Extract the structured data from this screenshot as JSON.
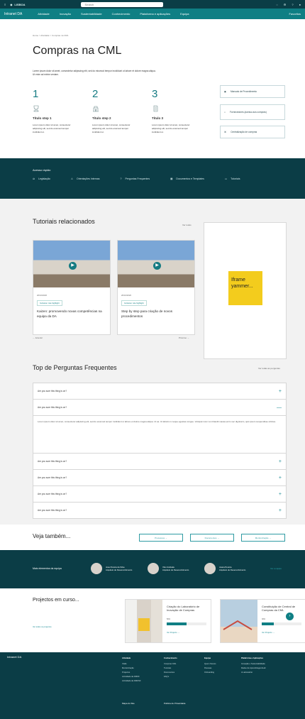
{
  "topbar": {
    "logo": "LISBOA",
    "search": "Search"
  },
  "nav": {
    "brand": "Intranet DA",
    "items": [
      "Atividade",
      "Inovação",
      "Sustentabilidade",
      "Conhecimento",
      "Plataforma e aplicações",
      "Equipa"
    ],
    "right": "Favoritos"
  },
  "page": {
    "breadcrumb": "Home > Atividade > Compras na CML",
    "title": "Compras na CML",
    "intro": "Lorem ipsum dolor sit amet, consectetur adipiscing elit, sed do eiusmod tempor incididunt ut labore et dolore magna aliqua. Ut enim ad minim veniam.",
    "steps": [
      {
        "num": "1",
        "title": "Título step 1",
        "text": "Lorem ipsum dolor sit amet, consectetur adipiscing elit, sed do eiusmod tempor incididunt ut."
      },
      {
        "num": "2",
        "title": "Título step 2",
        "text": "Lorem ipsum dolor sit amet, consectetur adipiscing elit, sed do eiusmod tempor incididunt ut."
      },
      {
        "num": "3",
        "title": "Título 3",
        "text": "Lorem ipsum dolor sit amet, consectetur adipiscing elit, sed do eiusmod tempor incididunt ut."
      }
    ],
    "side": [
      "Manuais de Procedimento",
      "Fornecedores (acesso aos compras)",
      "Centralização de compras"
    ]
  },
  "quick": {
    "label": "Acesso rápido",
    "items": [
      "Legislação",
      "Orientações Internas",
      "Perguntas Frequentes",
      "Documentos e Templates",
      "Tutoriais"
    ]
  },
  "tutorials": {
    "title": "Tutoriais relacionados",
    "more": "Ver todos",
    "cards": [
      {
        "date": "20/10/2020",
        "tag": "Inclusion rule highlight",
        "title": "Kaizen: promovendo novas competências na equipa da DA"
      },
      {
        "date": "20/10/2020",
        "tag": "Inclusion rule highlight",
        "title": "Step by step para criação de novos procedimentos"
      }
    ],
    "prev": "← Anterior",
    "next": "Próximo →",
    "iframe": "Iframe yammer..."
  },
  "faq": {
    "title": "Top de Perguntas Frequentes",
    "more": "Ver todas as perguntas",
    "questions": [
      "Are you sure this thing is on?",
      "Are you sure this thing is on?",
      "Are you sure this thing is on?",
      "Are you sure this thing is on?",
      "Are you sure this thing is on?",
      "Are you sure this thing is on?"
    ],
    "answer": "Lorem ipsum dolor sit amet, consectetur adipiscing elit, sed do eiusmod tempor incididunt ut labore et dolore magna aliqua. Ut as. Ut laboris in neque egestas congue. Volutpat nunc non blandit massa enim nec dignissim, quis ipsum suspendisse ultrices."
  },
  "also": {
    "title": "Veja também...",
    "buttons": [
      "Processos →",
      "Documentos →",
      "Monitorização →"
    ]
  },
  "team": {
    "label": "Mais elementos da equipa",
    "members": [
      {
        "name": "Jose Pereira da Silva",
        "role": "Arquiteto de Desenvolvimento"
      },
      {
        "name": "Vitor Andrade",
        "role": "Arquiteto de Desenvolvimento"
      },
      {
        "name": "Joana Pereira",
        "role": "Arquiteto de Desenvolvimento"
      }
    ],
    "more": "Ver a equipa"
  },
  "projects": {
    "title": "Projectos em curso...",
    "all": "Ver todos os projectos",
    "cards": [
      {
        "title": "Criação do Laboratório de Inovação de Compras",
        "percent": "50%",
        "link": "Ver Projecto →",
        "progress": 0.5
      },
      {
        "title": "Constituição de Central de Compras da CML",
        "percent": "30%",
        "link": "Ver Projecto →",
        "progress": 0.3
      }
    ]
  },
  "footer": {
    "brand": "Intranet DA",
    "cols": [
      {
        "head": "Atividade",
        "items": [
          "Visão",
          "Monitorização",
          "Projectos",
          "Actividade da DMOF",
          "Actividade da DMOSF"
        ]
      },
      {
        "head": "Conhecimento",
        "items": [
          "Compras CML",
          "Tutoriais",
          "Documentos",
          "FAQ's"
        ]
      },
      {
        "head": "Equipa",
        "items": [
          "Quem Somos",
          "Pessoas",
          "Onboarding"
        ]
      },
      {
        "head": "Plataforma e Aplicações",
        "items": [
          "Inovação e Sustentabilidade",
          "Redes de Aprendizagem/Lab",
          "A Laboratório"
        ]
      }
    ],
    "bottom": [
      "Mapa do Site",
      "Política de Privacidade"
    ]
  }
}
